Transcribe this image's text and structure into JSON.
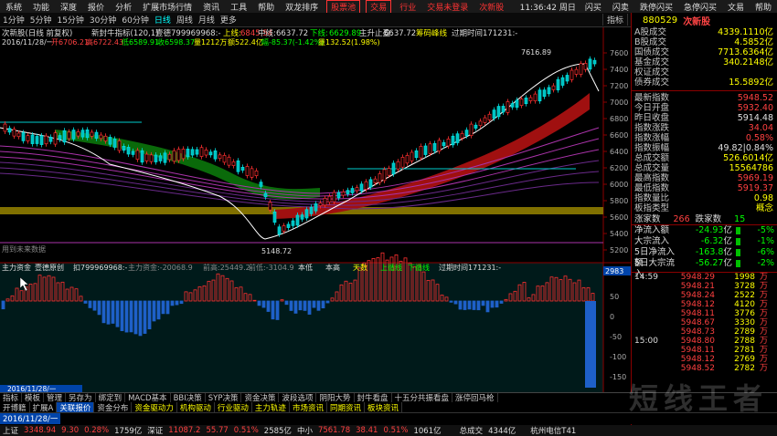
{
  "menu": {
    "items": [
      "系统",
      "功能",
      "深度",
      "报价",
      "分析",
      "扩展市场行情",
      "资讯",
      "工具",
      "帮助",
      "双龙排序"
    ],
    "boxed": [
      "股票池",
      "交易"
    ],
    "after": "行业",
    "account": [
      "交易未登录",
      "次新股"
    ],
    "clock": "11:36:42 周日",
    "right_tools": [
      "闪买",
      "闪卖",
      "跌停闪买",
      "急停闪买",
      "文易",
      "帮助"
    ]
  },
  "period": {
    "items": [
      "1分钟",
      "5分钟",
      "15分钟",
      "30分钟",
      "60分钟",
      "日线",
      "周线",
      "月线",
      "更多"
    ],
    "active": "日线",
    "tools": [
      "指标",
      "叠加",
      "画线",
      "F10",
      "标记",
      "-自选",
      "返回"
    ]
  },
  "chart": {
    "title": "次新股(日线 前复权)",
    "indicator": "新封牛指标(120,1)",
    "indicator_val": "壹德799969968:-",
    "upper_label": "上线:",
    "upper_val": "6845.54",
    "mid_label": "中线:",
    "mid_val": "6637.72",
    "lower_label": "下线:",
    "lower_val": "6629.89",
    "main_stop": "主升止盈:",
    "main_stop_val": "6637.72",
    "peak_text": "筹码峰线",
    "expire": "过期时间171231:-",
    "date_line": "2016/11/28/一",
    "open": "开6706.21",
    "high": "高6722.43",
    "low": "低6589.91",
    "close": "收6598.37",
    "volume": "量1212万",
    "amount": "额522.4亿",
    "change": "幅-85.37(-1.42%)",
    "turnover": "量132.52(1.98%)",
    "peak_label": "7616.89",
    "trough_label": "5148.72",
    "corner_note": "用到未来数据",
    "sub_title": "主力资金",
    "sub_indicator": "壹德原创",
    "sub_val": "扣799969968:-",
    "sub_ma": "主力资金:-20068.9",
    "sub_prev": "前高:25449.2",
    "sub_prev2": "前低:-3104.9",
    "sub_labels": [
      "本低",
      "本高",
      "天数",
      "上循线",
      "下循线"
    ],
    "sub_expire": "过期时间171231:-",
    "sub_num": "2983",
    "date_bar": "2016/11/28/一",
    "y_ticks": [
      "7600",
      "7400",
      "7200",
      "7000",
      "6800",
      "6600",
      "6400",
      "6200",
      "6000",
      "5800",
      "5600",
      "5400",
      "5200"
    ],
    "sub_ticks": [
      "50",
      "0",
      "-50",
      "-100",
      "-150"
    ]
  },
  "chart_data": {
    "type": "candlestick",
    "title": "次新股(日线 前复权)",
    "y_range": [
      5148.72,
      7616.89
    ],
    "annotations": {
      "high": 7616.89,
      "low": 5148.72
    },
    "latest": {
      "date": "2016/11/28",
      "open": 6706.21,
      "high": 6722.43,
      "low": 6589.91,
      "close": 6598.37
    }
  },
  "panel": {
    "code": "880529",
    "name": "次新股",
    "stats": [
      {
        "k": "A股成交",
        "v": "4339.1110亿",
        "c": "y"
      },
      {
        "k": "B股成交",
        "v": "4.5852亿",
        "c": "y"
      },
      {
        "k": "国债成交",
        "v": "7713.6364亿",
        "c": "y"
      },
      {
        "k": "基金成交",
        "v": "340.2148亿",
        "c": "y"
      },
      {
        "k": "权证成交",
        "v": "",
        "c": "y"
      },
      {
        "k": "债券成交",
        "v": "15.5892亿",
        "c": "y"
      }
    ],
    "quote": [
      {
        "k": "最新指数",
        "v": "5948.52",
        "c": "red"
      },
      {
        "k": "今日开盘",
        "v": "5932.40",
        "c": "red"
      },
      {
        "k": "昨日收盘",
        "v": "5914.48",
        "c": "white"
      },
      {
        "k": "指数涨跌",
        "v": "34.04",
        "c": "red"
      },
      {
        "k": "指数涨幅",
        "v": "0.58%",
        "c": "red"
      },
      {
        "k": "指数振幅",
        "v": "49.82|0.84%",
        "c": "white"
      },
      {
        "k": "总成交额",
        "v": "526.6014亿",
        "c": "y"
      },
      {
        "k": "总成交量",
        "v": "15564786",
        "c": "y"
      },
      {
        "k": "最高指数",
        "v": "5969.19",
        "c": "red"
      },
      {
        "k": "最低指数",
        "v": "5919.37",
        "c": "red"
      },
      {
        "k": "指数量比",
        "v": "0.98",
        "c": "y"
      },
      {
        "k": "板指类型",
        "v": "概念",
        "c": "y"
      }
    ],
    "up_label": "涨家数",
    "up": "266",
    "down_label": "跌家数",
    "down": "15",
    "flows": [
      {
        "k": "净流入额",
        "v": "-24.93",
        "p": "-5%"
      },
      {
        "k": "大宗流入",
        "v": "-6.32",
        "p": "-1%"
      },
      {
        "k": "5日净流入额",
        "v": "-163.8",
        "p": "-6%"
      },
      {
        "k": "5日大宗流入",
        "v": "-56.27",
        "p": "-2%"
      }
    ],
    "flow_unit": "亿",
    "ticks": [
      {
        "t": "14:59",
        "pr": "5948.29",
        "vol": "1998",
        "bs": "万"
      },
      {
        "t": "",
        "pr": "5948.21",
        "vol": "3728",
        "bs": "万"
      },
      {
        "t": "",
        "pr": "5948.24",
        "vol": "2522",
        "bs": "万"
      },
      {
        "t": "",
        "pr": "5948.12",
        "vol": "4120",
        "bs": "万"
      },
      {
        "t": "",
        "pr": "5948.11",
        "vol": "3776",
        "bs": "万"
      },
      {
        "t": "",
        "pr": "5948.67",
        "vol": "3330",
        "bs": "万"
      },
      {
        "t": "",
        "pr": "5948.73",
        "vol": "2789",
        "bs": "万"
      },
      {
        "t": "15:00",
        "pr": "5948.80",
        "vol": "2788",
        "bs": "万"
      },
      {
        "t": "",
        "pr": "5948.11",
        "vol": "2781",
        "bs": "万"
      },
      {
        "t": "",
        "pr": "5948.12",
        "vol": "2769",
        "bs": "万"
      },
      {
        "t": "",
        "pr": "5948.52",
        "vol": "2782",
        "bs": "万"
      }
    ]
  },
  "tabs1": [
    "指标",
    "模板",
    "管理",
    "另存为",
    "绑定到",
    "MACD基本",
    "BBI决策",
    "SYP决策",
    "资金决策",
    "波段选项",
    "阴阳大势",
    "封牛看盘",
    "十五分共振看盘",
    "涨停回马枪"
  ],
  "tabs2": [
    "开博籍",
    "扩展A",
    "关联报价",
    "资金分布",
    "资金驱动力",
    "机构驱动",
    "行业驱动",
    "主力轨迹",
    "市场资讯",
    "同期资讯",
    "板块资讯"
  ],
  "status": {
    "sh_label": "上证",
    "sh": "3348.94",
    "sh_chg": "9.30",
    "sh_pct": "0.28%",
    "sh_amt": "1759亿",
    "sz_label": "深证",
    "sz": "11087.2",
    "sz_chg": "55.77",
    "sz_pct": "0.51%",
    "sz_amt": "2585亿",
    "zx_label": "中小",
    "zx": "7561.78",
    "zx_chg": "38.41",
    "zx_pct": "0.51%",
    "zx_amt": "1061亿",
    "total_label": "总成交",
    "total": "4344亿",
    "server": "杭州电信T41"
  },
  "watermark": "短线王者"
}
